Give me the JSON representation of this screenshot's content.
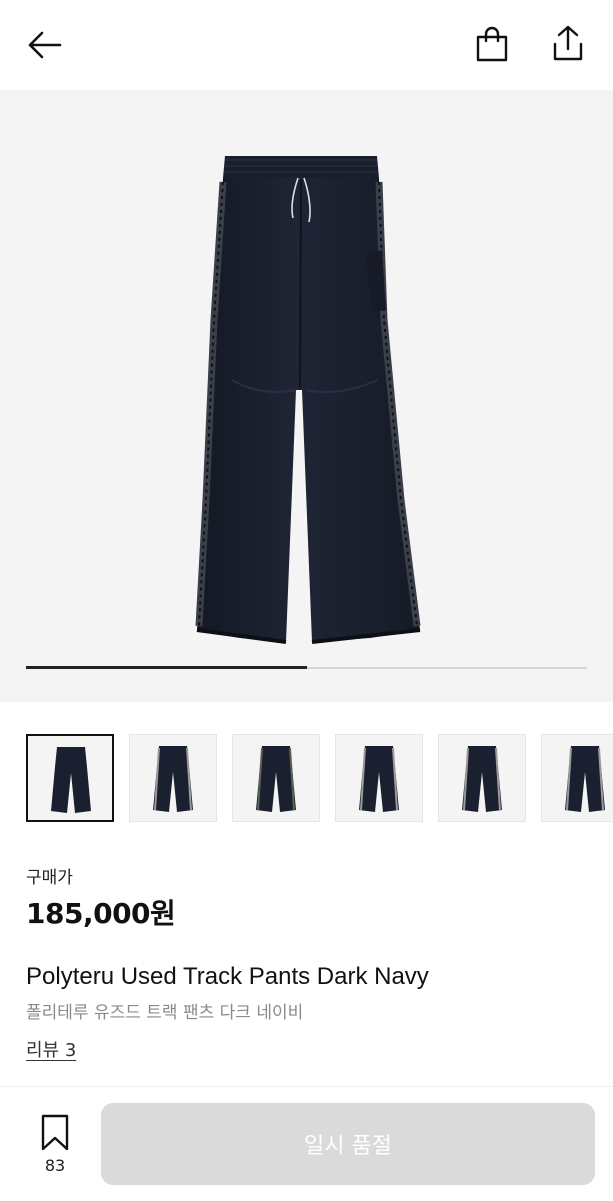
{
  "header": {
    "back_icon": "arrow-left-icon",
    "bag_icon": "shopping-bag-icon",
    "share_icon": "share-icon"
  },
  "gallery": {
    "progress": 0.5,
    "thumbnail_count": 6,
    "active_index": 0
  },
  "product": {
    "price_label": "구매가",
    "price": "185,000원",
    "name_en": "Polyteru Used Track Pants Dark Navy",
    "name_ko": "폴리테루 유즈드 트랙 팬츠 다크 네이비",
    "review_link": "리뷰 3"
  },
  "footer": {
    "bookmark_icon": "bookmark-icon",
    "bookmark_count": "83",
    "buy_button": "일시 품절"
  },
  "colors": {
    "accent_dark": "#111111",
    "disabled_button": "#dadada",
    "image_background": "#f4f4f4",
    "product_navy": "#1b2030"
  }
}
